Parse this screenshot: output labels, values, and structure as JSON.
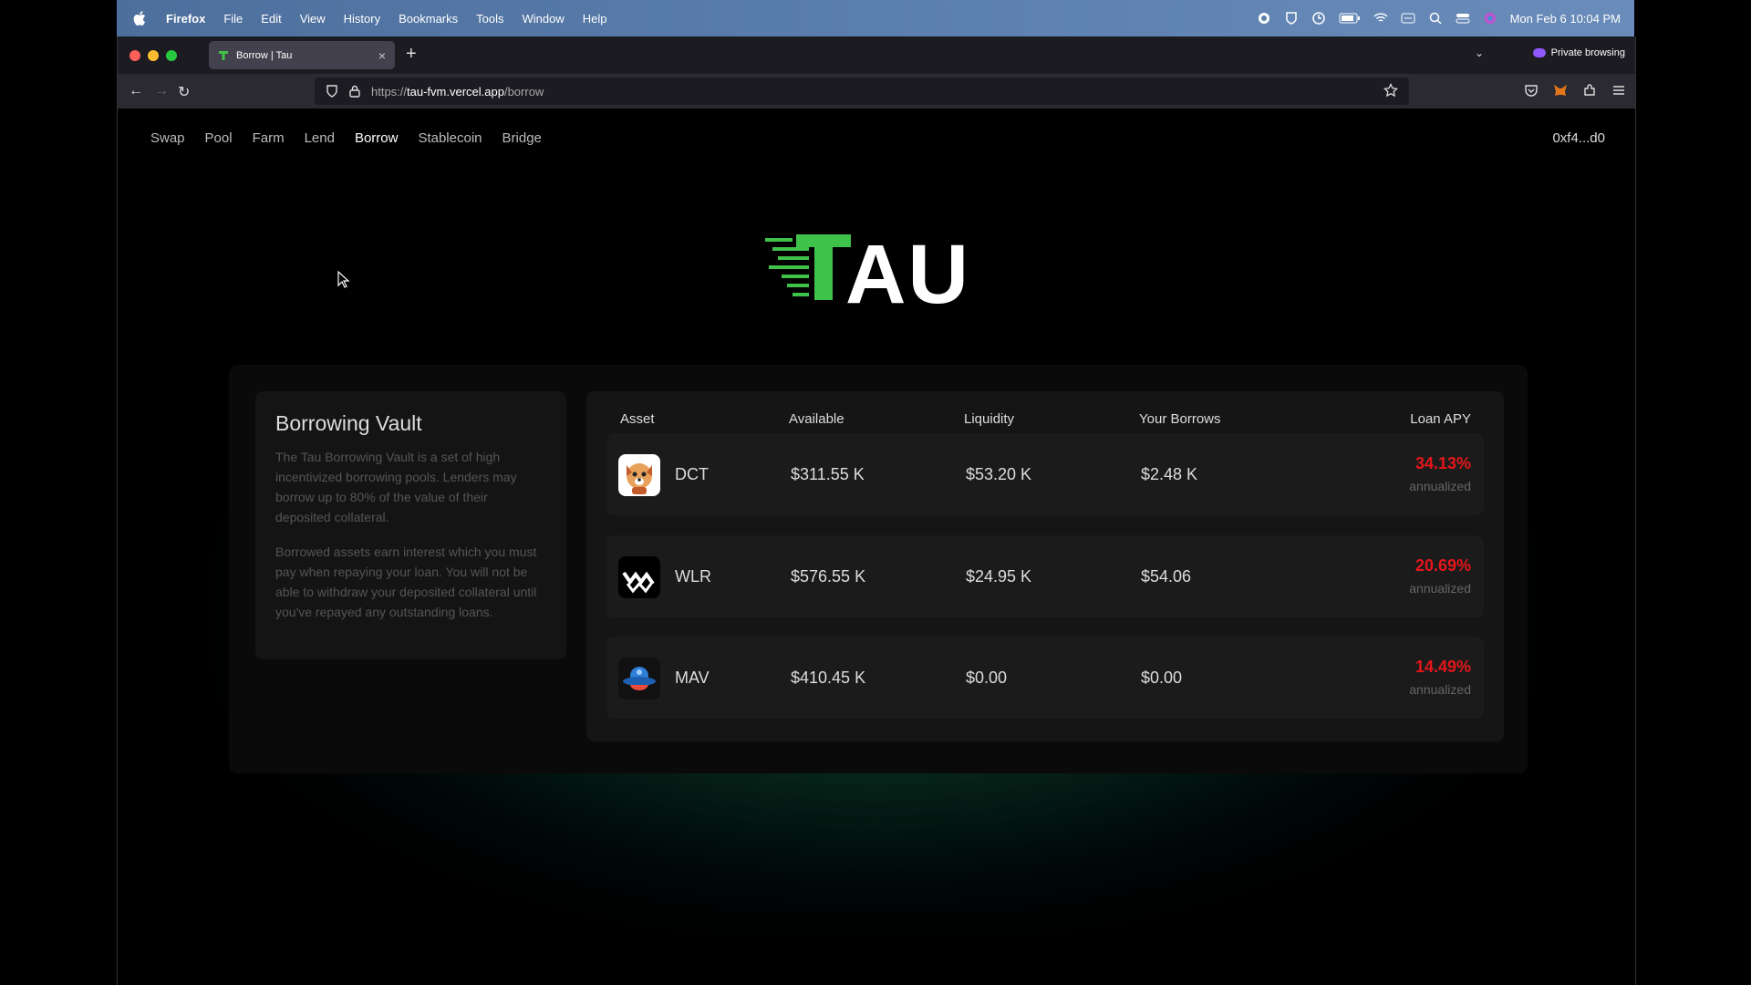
{
  "menubar": {
    "app": "Firefox",
    "items": [
      "File",
      "Edit",
      "View",
      "History",
      "Bookmarks",
      "Tools",
      "Window",
      "Help"
    ],
    "datetime": "Mon Feb 6  10:04 PM"
  },
  "browser": {
    "tab_title": "Borrow | Tau",
    "private_label": "Private browsing",
    "url_prefix": "https://",
    "url_domain": "tau-fvm.vercel.app",
    "url_path": "/borrow"
  },
  "site": {
    "nav": [
      "Swap",
      "Pool",
      "Farm",
      "Lend",
      "Borrow",
      "Stablecoin",
      "Bridge"
    ],
    "active_nav": "Borrow",
    "wallet": "0xf4...d0",
    "logo_text": "AU"
  },
  "vault": {
    "title": "Borrowing Vault",
    "para1": "The Tau Borrowing Vault is a set of high incentivized borrowing pools. Lenders may borrow up to 80% of the value of their deposited collateral.",
    "para2": "Borrowed assets earn interest which you must pay when repaying your loan. You will not be able to withdraw your deposited collateral until you've repayed any outstanding loans."
  },
  "table": {
    "headers": {
      "asset": "Asset",
      "available": "Available",
      "liquidity": "Liquidity",
      "borrows": "Your Borrows",
      "apy": "Loan APY"
    },
    "rows": [
      {
        "symbol": "DCT",
        "available": "$311.55 K",
        "liquidity": "$53.20 K",
        "borrows": "$2.48 K",
        "apy": "34.13%",
        "apy_note": "annualized",
        "icon": "dog-icon"
      },
      {
        "symbol": "WLR",
        "available": "$576.55 K",
        "liquidity": "$24.95 K",
        "borrows": "$54.06",
        "apy": "20.69%",
        "apy_note": "annualized",
        "icon": "wlr-icon"
      },
      {
        "symbol": "MAV",
        "available": "$410.45 K",
        "liquidity": "$0.00",
        "borrows": "$0.00",
        "apy": "14.49%",
        "apy_note": "annualized",
        "icon": "ufo-icon"
      }
    ]
  },
  "colors": {
    "accent_green": "#3fc24a",
    "apy_red": "#e5161b"
  }
}
